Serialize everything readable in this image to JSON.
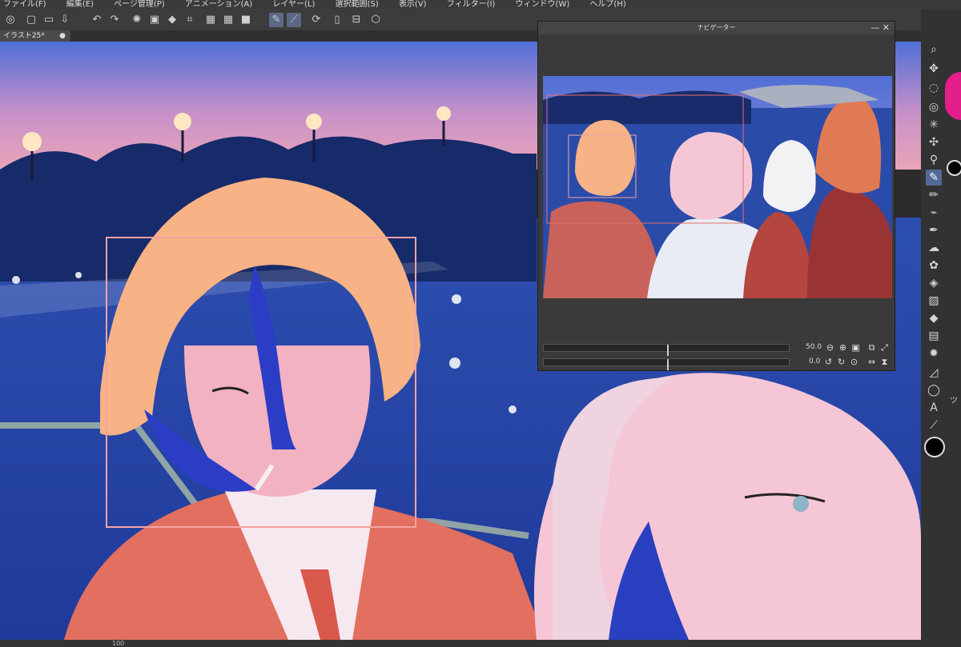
{
  "menu": [
    "ファイル(F)",
    "編集(E)",
    "ページ管理(P)",
    "アニメーション(A)",
    "レイヤー(L)",
    "選択範囲(S)",
    "表示(V)",
    "フィルター(I)",
    "ウィンドウ(W)",
    "ヘルプ(H)"
  ],
  "tab": {
    "title": "イラスト25*",
    "close": "●"
  },
  "navigator": {
    "title": "ナビゲーター",
    "zoom_value": "50.0",
    "rotate_value": "0.0"
  },
  "statusbar": {
    "zoom": "100"
  },
  "right_panel": {
    "label_fragment": "ツ"
  },
  "colors": {
    "accent": "#5a6a86",
    "canvas_frame": "#f5a3a3",
    "panel": "#323232"
  },
  "icons": {
    "toolbar": [
      "app-logo-icon",
      "new-file-icon",
      "open-folder-icon",
      "save-icon",
      "undo-icon",
      "redo-icon",
      "loading-icon",
      "fill-icon",
      "transform-icon",
      "grid-icon",
      "pen-icon",
      "ruler-icon",
      "refresh-icon",
      "device-icon",
      "select-layer-icon"
    ],
    "tools": [
      "zoom-icon",
      "move-icon",
      "lasso-select-icon",
      "auto-select-icon",
      "sparkle-icon",
      "move-arrows-icon",
      "eyedropper-icon",
      "pen-tool-icon",
      "pencil-tool-icon",
      "brush-tool-icon",
      "marker-tool-icon",
      "blend-tool-icon",
      "airbrush-icon",
      "decoration-icon",
      "eraser-icon",
      "gradient-icon",
      "fill-bucket-icon",
      "frame-icon",
      "burst-icon",
      "figure-icon",
      "balloon-icon",
      "text-icon",
      "correction-icon"
    ]
  }
}
